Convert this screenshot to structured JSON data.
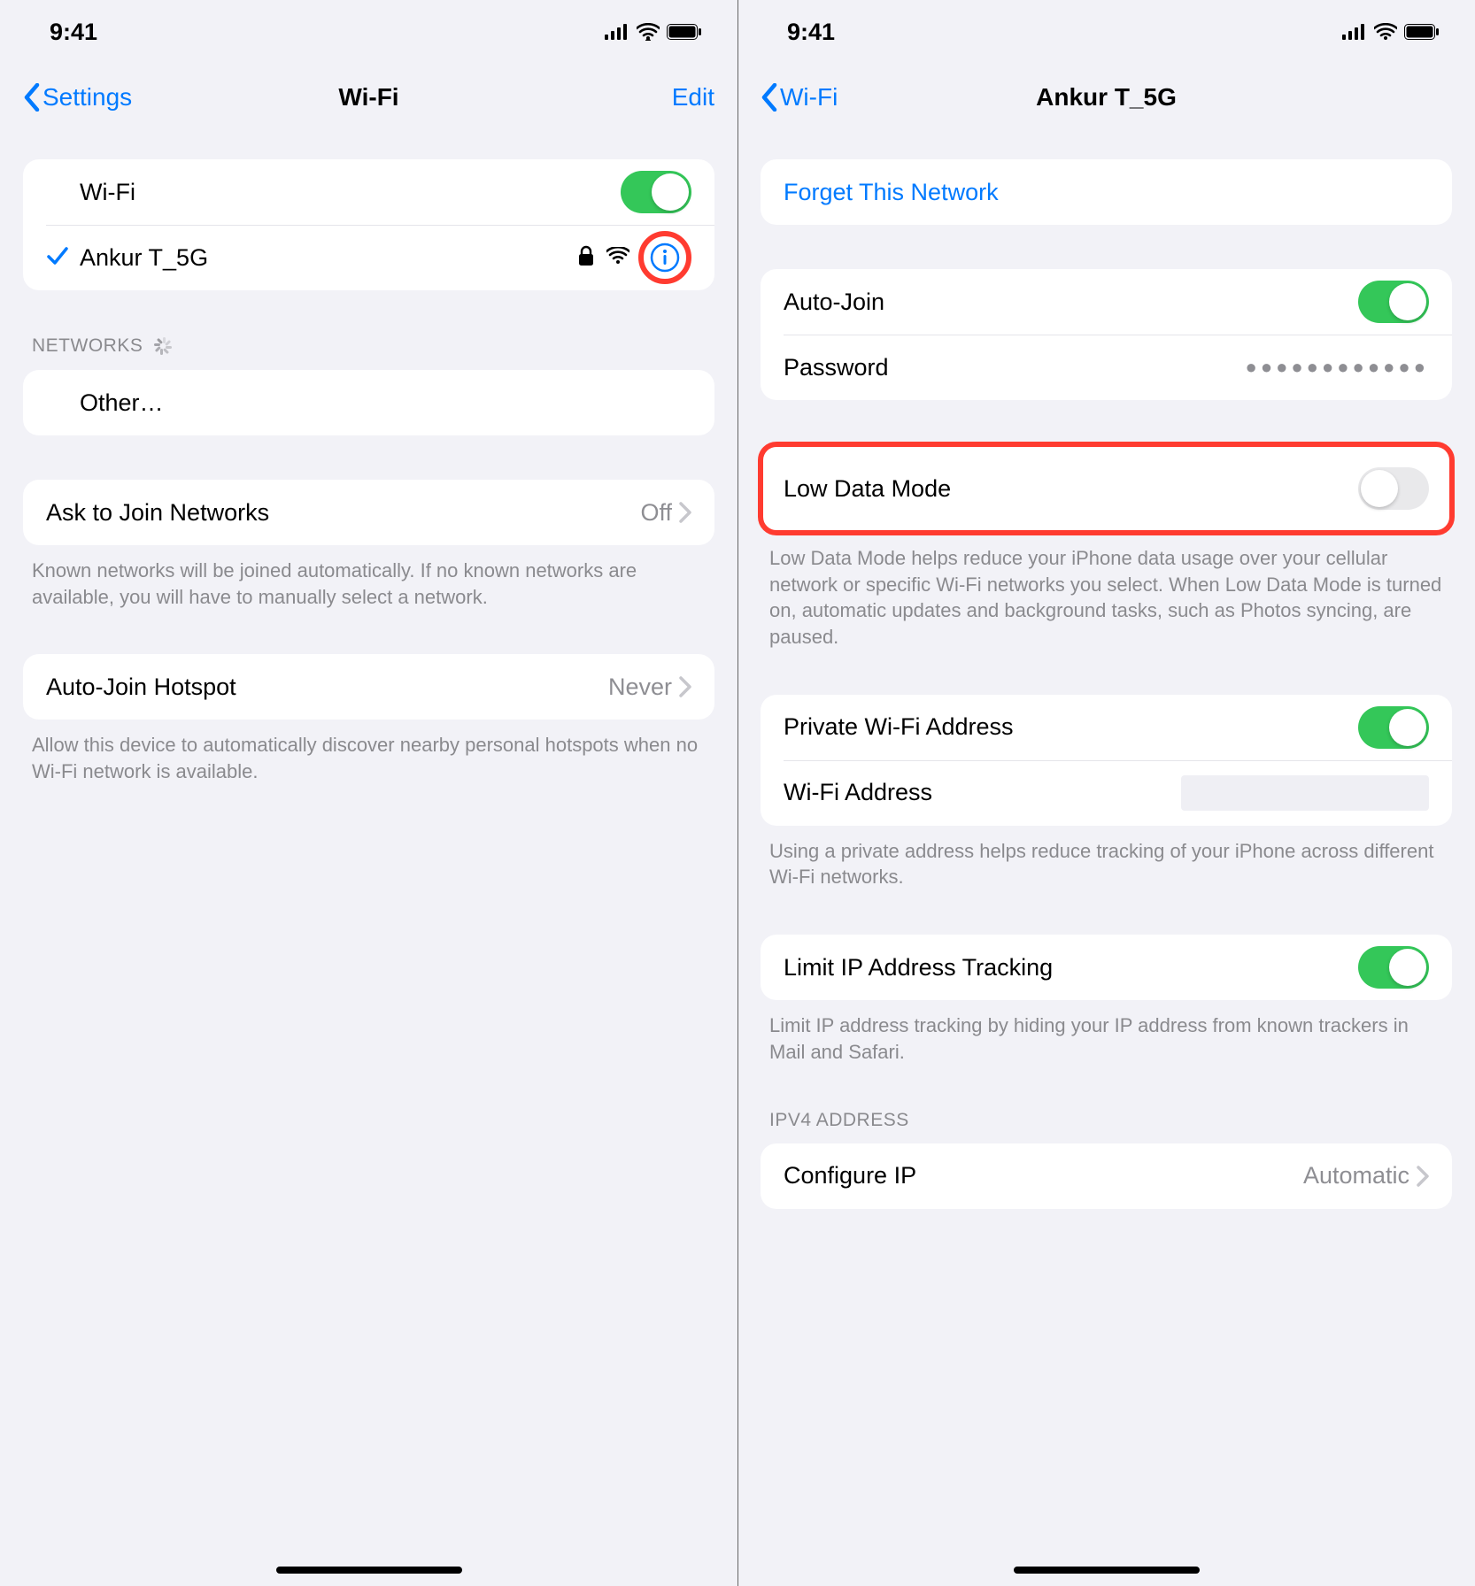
{
  "status": {
    "time": "9:41"
  },
  "left": {
    "back_label": "Settings",
    "title": "Wi-Fi",
    "edit_label": "Edit",
    "wifi_label": "Wi-Fi",
    "wifi_on": true,
    "connected_name": "Ankur T_5G",
    "networks_header": "NETWORKS",
    "other_label": "Other…",
    "ask_label": "Ask to Join Networks",
    "ask_value": "Off",
    "ask_footer": "Known networks will be joined automatically. If no known networks are available, you will have to manually select a network.",
    "autojoin_label": "Auto-Join Hotspot",
    "autojoin_value": "Never",
    "autojoin_footer": "Allow this device to automatically discover nearby personal hotspots when no Wi-Fi network is available."
  },
  "right": {
    "back_label": "Wi-Fi",
    "title": "Ankur T_5G",
    "forget_label": "Forget This Network",
    "autojoin_label": "Auto-Join",
    "autojoin_on": true,
    "password_label": "Password",
    "password_mask": "●●●●●●●●●●●●",
    "lowdata_label": "Low Data Mode",
    "lowdata_on": false,
    "lowdata_footer": "Low Data Mode helps reduce your iPhone data usage over your cellular network or specific Wi-Fi networks you select. When Low Data Mode is turned on, automatic updates and background tasks, such as Photos syncing, are paused.",
    "private_label": "Private Wi-Fi Address",
    "private_on": true,
    "addr_label": "Wi-Fi Address",
    "private_footer": "Using a private address helps reduce tracking of your iPhone across different Wi-Fi networks.",
    "limitip_label": "Limit IP Address Tracking",
    "limitip_on": true,
    "limitip_footer": "Limit IP address tracking by hiding your IP address from known trackers in Mail and Safari.",
    "ipv4_header": "IPV4 ADDRESS",
    "configip_label": "Configure IP",
    "configip_value": "Automatic"
  }
}
